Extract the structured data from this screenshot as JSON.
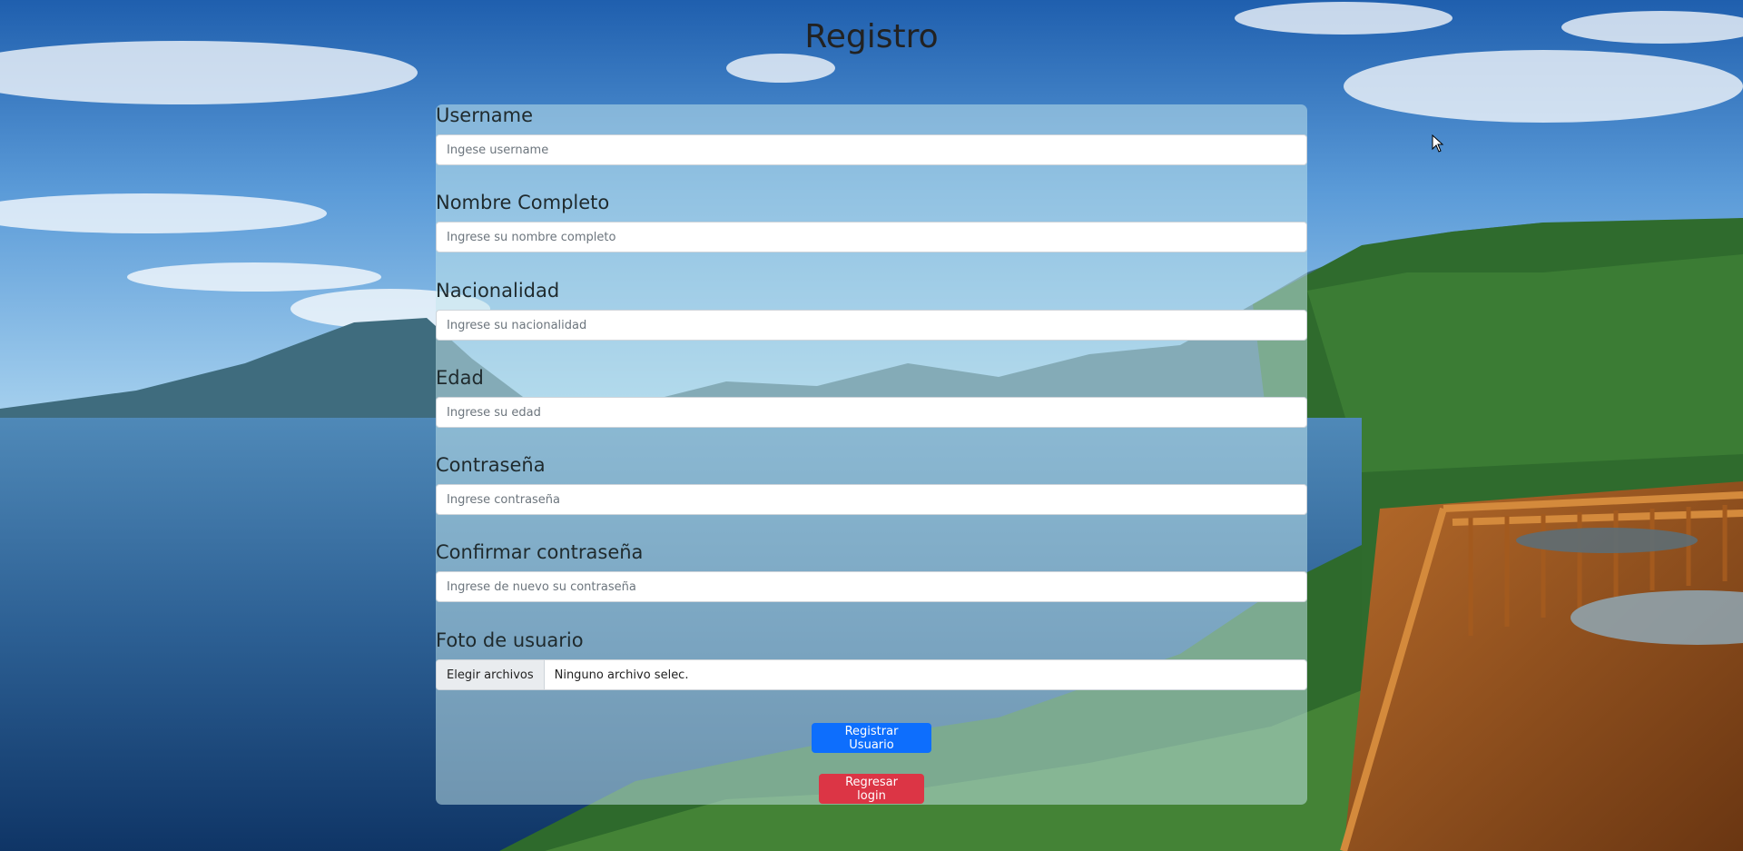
{
  "page": {
    "title": "Registro"
  },
  "form": {
    "fields": [
      {
        "label": "Username",
        "placeholder": "Ingese username",
        "value": ""
      },
      {
        "label": "Nombre Completo",
        "placeholder": "Ingrese su nombre completo",
        "value": ""
      },
      {
        "label": "Nacionalidad",
        "placeholder": "Ingrese su nacionalidad",
        "value": ""
      },
      {
        "label": "Edad",
        "placeholder": "Ingrese su edad",
        "value": ""
      },
      {
        "label": "Contraseña",
        "placeholder": "Ingrese contraseña",
        "value": ""
      },
      {
        "label": "Confirmar contraseña",
        "placeholder": "Ingrese de nuevo su contraseña",
        "value": ""
      }
    ],
    "photo": {
      "label": "Foto de usuario",
      "button_label": "Elegir archivos",
      "status_text": "Ninguno archivo selec."
    },
    "submit_label": "Registrar Usuario",
    "back_label": "Regresar login"
  },
  "colors": {
    "primary": "#0d6efd",
    "danger": "#dc3545",
    "card_overlay": "rgba(195,230,235,0.52)"
  }
}
